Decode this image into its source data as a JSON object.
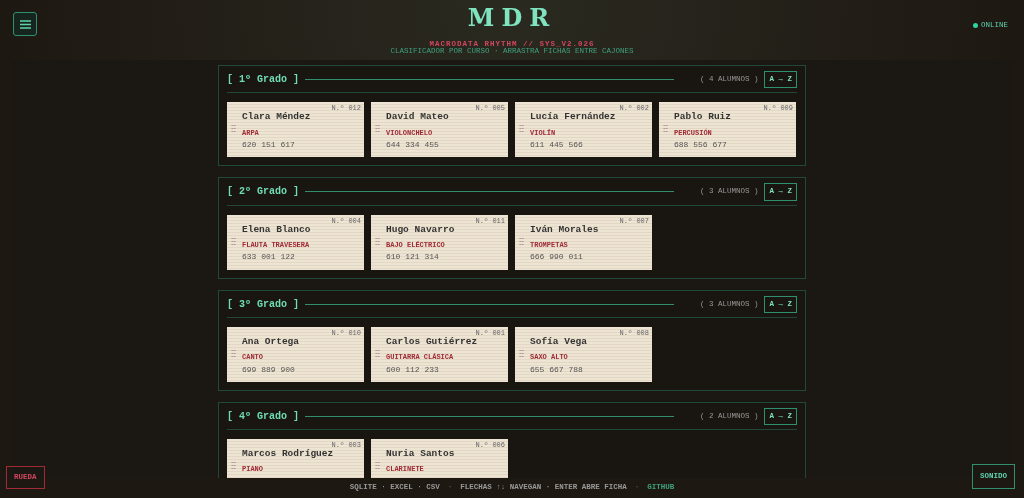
{
  "header": {
    "title": "MDR",
    "subtitle": "MACRODATA RHYTHM // SYS_V2.026",
    "status": "ONLINE",
    "online": true
  },
  "hint": "CLASIFICADOR POR CURSO · ARRASTRA FICHAS ENTRE CAJONES",
  "groups": [
    {
      "title": "[ 1º Grado ]",
      "count": "( 4 ALUMNOS )",
      "sort": "A → Z",
      "cards": [
        {
          "number": "N.º 012",
          "name": "Clara Méndez",
          "instrument": "ARPA",
          "phone": "620 151 617"
        },
        {
          "number": "N.º 005",
          "name": "David Mateo",
          "instrument": "VIOLONCHELO",
          "phone": "644 334 455"
        },
        {
          "number": "N.º 002",
          "name": "Lucía Fernández",
          "instrument": "VIOLÍN",
          "phone": "611 445 566"
        },
        {
          "number": "N.º 009",
          "name": "Pablo Ruiz",
          "instrument": "PERCUSIÓN",
          "phone": "688 556 677"
        }
      ]
    },
    {
      "title": "[ 2º Grado ]",
      "count": "( 3 ALUMNOS )",
      "sort": "A → Z",
      "cards": [
        {
          "number": "N.º 004",
          "name": "Elena Blanco",
          "instrument": "FLAUTA TRAVESERA",
          "phone": "633 001 122"
        },
        {
          "number": "N.º 011",
          "name": "Hugo Navarro",
          "instrument": "BAJO ELÉCTRICO",
          "phone": "610 121 314"
        },
        {
          "number": "N.º 007",
          "name": "Iván Morales",
          "instrument": "TROMPETAS",
          "phone": "666 990 011"
        }
      ]
    },
    {
      "title": "[ 3º Grado ]",
      "count": "( 3 ALUMNOS )",
      "sort": "A → Z",
      "cards": [
        {
          "number": "N.º 010",
          "name": "Ana Ortega",
          "instrument": "CANTO",
          "phone": "699 889 900"
        },
        {
          "number": "N.º 001",
          "name": "Carlos Gutiérrez",
          "instrument": "GUITARRA CLÁSICA",
          "phone": "600 112 233"
        },
        {
          "number": "N.º 008",
          "name": "Sofía Vega",
          "instrument": "SAXO ALTO",
          "phone": "655 667 788"
        }
      ]
    },
    {
      "title": "[ 4º Grado ]",
      "count": "( 2 ALUMNOS )",
      "sort": "A → Z",
      "cards": [
        {
          "number": "N.º 003",
          "name": "Marcos Rodríguez",
          "instrument": "PIANO"
        },
        {
          "number": "N.º 006",
          "name": "Nuria Santos",
          "instrument": "CLARINETE"
        }
      ]
    }
  ],
  "footer": [
    {
      "text": "SQLITE · EXCEL · CSV",
      "kind": "text"
    },
    {
      "text": "·",
      "kind": "sep"
    },
    {
      "text": "FLECHAS ↑↓ NAVEGAN · ENTER ABRE FICHA",
      "kind": "text"
    },
    {
      "text": "·",
      "kind": "sep"
    },
    {
      "text": "GITHUB",
      "kind": "link"
    }
  ],
  "left_button": "RUEDA",
  "right_button": "SONIDO"
}
